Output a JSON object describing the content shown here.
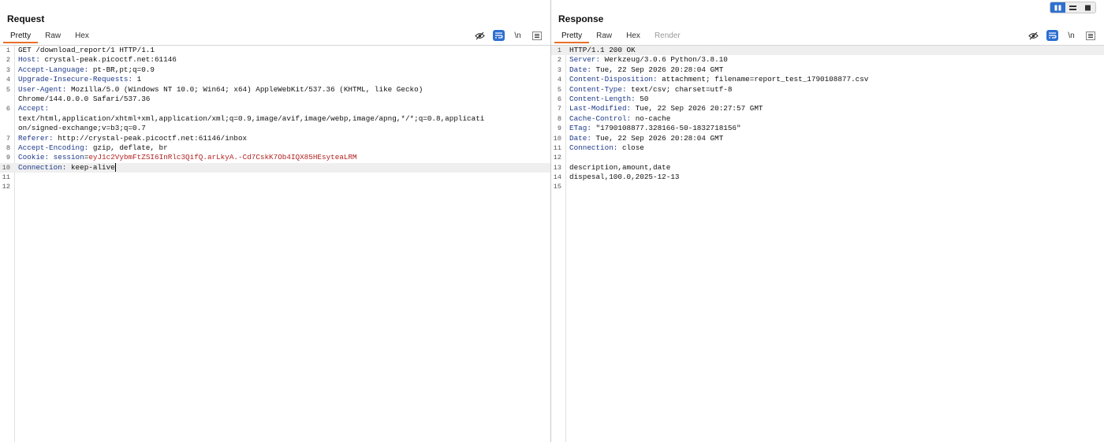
{
  "request": {
    "title": "Request",
    "tabs": [
      "Pretty",
      "Raw",
      "Hex"
    ],
    "active_tab": "Pretty",
    "tools": {
      "hide_icon": "eye-slash-icon",
      "wrap_icon": "word-wrap-icon",
      "newline_label": "\\n",
      "menu_icon": "hamburger-menu-icon"
    },
    "lines": [
      {
        "num": "1",
        "text": "GET /download_report/1 HTTP/1.1"
      },
      {
        "num": "2",
        "key": "Host:",
        "value": " crystal-peak.picoctf.net:61146"
      },
      {
        "num": "3",
        "key": "Accept-Language:",
        "value": " pt-BR,pt;q=0.9"
      },
      {
        "num": "4",
        "key": "Upgrade-Insecure-Requests:",
        "value": " 1"
      },
      {
        "num": "5",
        "key": "User-Agent:",
        "value": " Mozilla/5.0 (Windows NT 10.0; Win64; x64) AppleWebKit/537.36 (KHTML, like Gecko)"
      },
      {
        "num": "",
        "text": "Chrome/144.0.0.0 Safari/537.36"
      },
      {
        "num": "6",
        "key": "Accept:",
        "value": ""
      },
      {
        "num": "",
        "text": "text/html,application/xhtml+xml,application/xml;q=0.9,image/avif,image/webp,image/apng,*/*;q=0.8,applicati"
      },
      {
        "num": "",
        "text": "on/signed-exchange;v=b3;q=0.7"
      },
      {
        "num": "7",
        "key": "Referer:",
        "value": " http://crystal-peak.picoctf.net:61146/inbox"
      },
      {
        "num": "8",
        "key": "Accept-Encoding:",
        "value": " gzip, deflate, br"
      },
      {
        "num": "9",
        "key": "Cookie:",
        "value": " ",
        "cookie_name": "session",
        "cookie_eq": "=",
        "cookie_value": "eyJ1c2VybmFtZSI6InRlc3QifQ.arLkyA.-Cd7CskK7Ob4IQX85HEsyteaLRM"
      },
      {
        "num": "10",
        "key": "Connection:",
        "value": " keep-alive",
        "highlight": true,
        "caret": true
      },
      {
        "num": "11",
        "text": ""
      },
      {
        "num": "12",
        "text": ""
      }
    ]
  },
  "response": {
    "title": "Response",
    "tabs": [
      "Pretty",
      "Raw",
      "Hex",
      "Render"
    ],
    "active_tab": "Pretty",
    "disabled_tabs": [
      "Render"
    ],
    "tools": {
      "hide_icon": "eye-slash-icon",
      "wrap_icon": "word-wrap-icon",
      "newline_label": "\\n",
      "menu_icon": "hamburger-menu-icon"
    },
    "lines": [
      {
        "num": "1",
        "text": "HTTP/1.1 200 OK",
        "highlight": true
      },
      {
        "num": "2",
        "key": "Server:",
        "value": " Werkzeug/3.0.6 Python/3.8.10"
      },
      {
        "num": "3",
        "key": "Date:",
        "value": " Tue, 22 Sep 2026 20:28:04 GMT"
      },
      {
        "num": "4",
        "key": "Content-Disposition:",
        "value": " attachment; filename=report_test_1790108877.csv"
      },
      {
        "num": "5",
        "key": "Content-Type:",
        "value": " text/csv; charset=utf-8"
      },
      {
        "num": "6",
        "key": "Content-Length:",
        "value": " 50"
      },
      {
        "num": "7",
        "key": "Last-Modified:",
        "value": " Tue, 22 Sep 2026 20:27:57 GMT"
      },
      {
        "num": "8",
        "key": "Cache-Control:",
        "value": " no-cache"
      },
      {
        "num": "9",
        "key": "ETag:",
        "value": " \"1790108877.328166-50-1832718156\""
      },
      {
        "num": "10",
        "key": "Date:",
        "value": " Tue, 22 Sep 2026 20:28:04 GMT"
      },
      {
        "num": "11",
        "key": "Connection:",
        "value": " close"
      },
      {
        "num": "12",
        "text": ""
      },
      {
        "num": "13",
        "text": "description,amount,date"
      },
      {
        "num": "14",
        "text": "dispesal,100.0,2025-12-13"
      },
      {
        "num": "15",
        "text": ""
      }
    ]
  },
  "layout_toggle": {
    "buttons": [
      "side-by-side-icon",
      "stacked-icon",
      "single-pane-icon"
    ],
    "active": 0
  },
  "colors": {
    "accent": "#e8702a",
    "selected": "#2e6fd1",
    "header_key": "#1e3a8a",
    "cookie_value": "#b22222"
  }
}
